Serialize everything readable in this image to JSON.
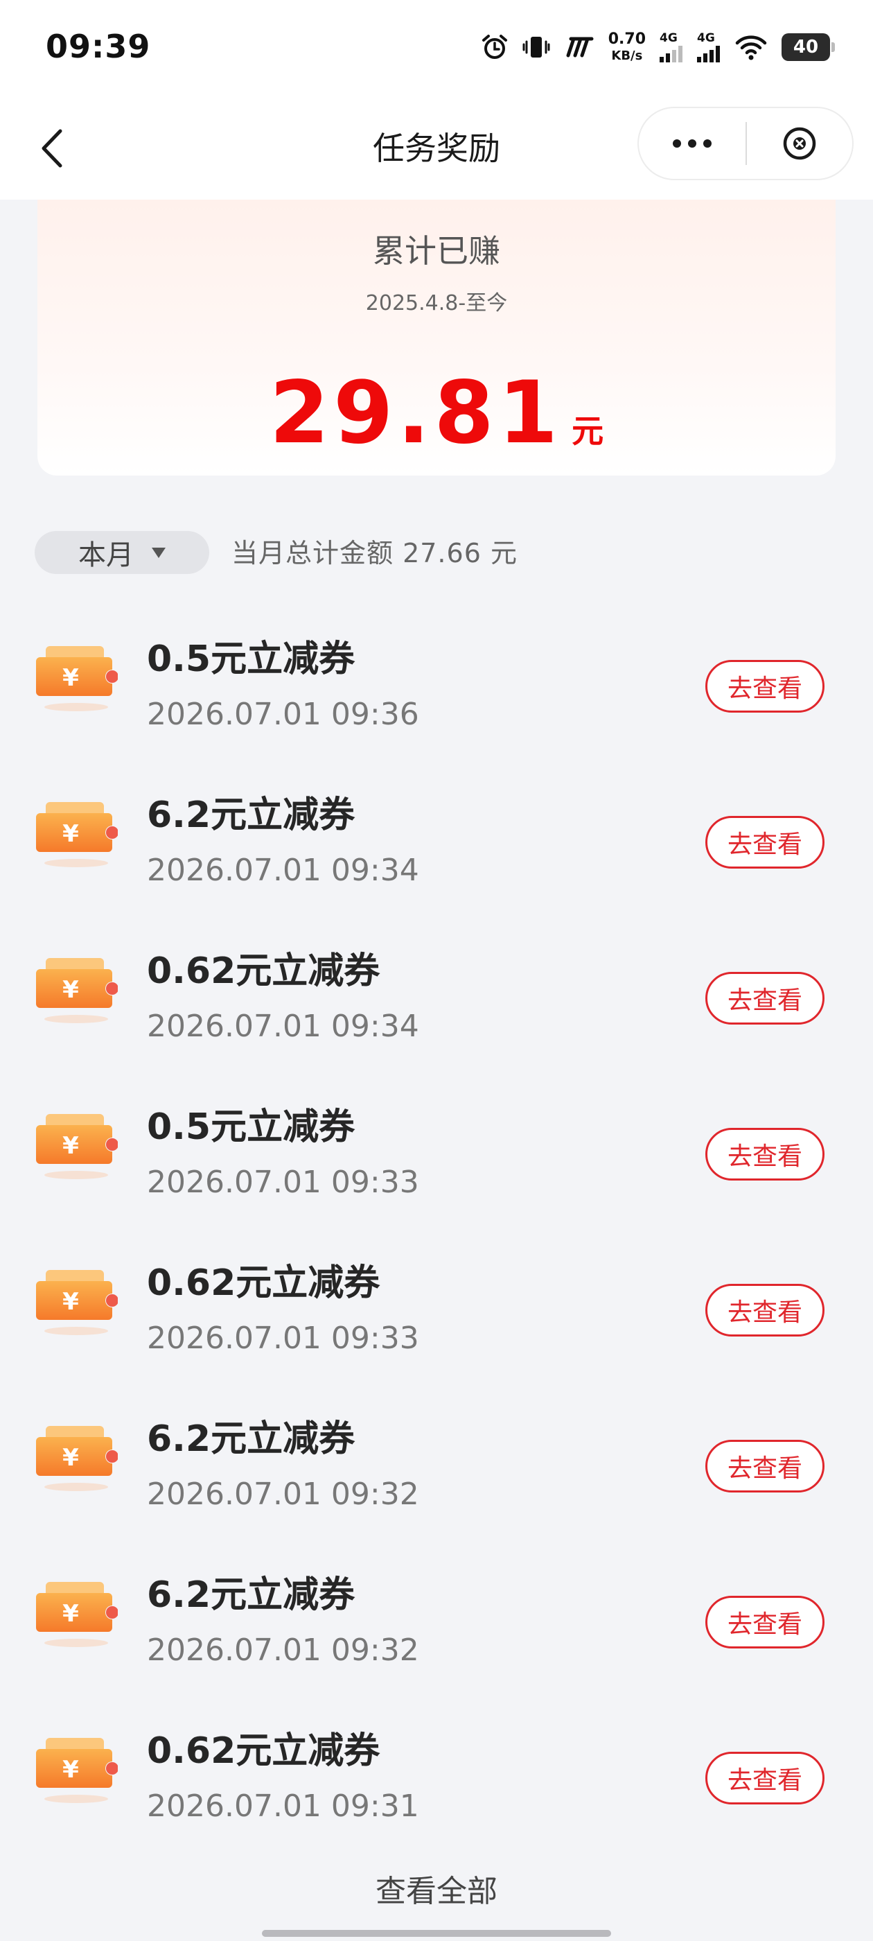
{
  "status_bar": {
    "time": "09:39",
    "net_speed_value": "0.70",
    "net_speed_unit": "KB/s",
    "signal1_label": "4G",
    "signal2_label": "4G",
    "battery": "40",
    "icons": [
      "alarm-icon",
      "vibrate-icon",
      "nfc-icon",
      "signal-icon",
      "signal-icon",
      "wifi-icon",
      "battery-icon"
    ]
  },
  "nav": {
    "title": "任务奖励"
  },
  "summary": {
    "title": "累计已赚",
    "range": "2025.4.8-至今",
    "amount": "29.81",
    "unit": "元"
  },
  "filter": {
    "label": "本月",
    "month_total": "当月总计金额 27.66 元"
  },
  "items": [
    {
      "title": "0.5元立减券",
      "time": "2026.07.01 09:36",
      "button": "去查看"
    },
    {
      "title": "6.2元立减券",
      "time": "2026.07.01 09:34",
      "button": "去查看"
    },
    {
      "title": "0.62元立减券",
      "time": "2026.07.01 09:34",
      "button": "去查看"
    },
    {
      "title": "0.5元立减券",
      "time": "2026.07.01 09:33",
      "button": "去查看"
    },
    {
      "title": "0.62元立减券",
      "time": "2026.07.01 09:33",
      "button": "去查看"
    },
    {
      "title": "6.2元立减券",
      "time": "2026.07.01 09:32",
      "button": "去查看"
    },
    {
      "title": "6.2元立减券",
      "time": "2026.07.01 09:32",
      "button": "去查看"
    },
    {
      "title": "0.62元立减券",
      "time": "2026.07.01 09:31",
      "button": "去查看"
    }
  ],
  "view_all": "查看全部",
  "colors": {
    "accent_red": "#ee0a0a",
    "button_red": "#e0262c",
    "coupon_orange": "#f7923a",
    "background": "#f3f4f7"
  }
}
